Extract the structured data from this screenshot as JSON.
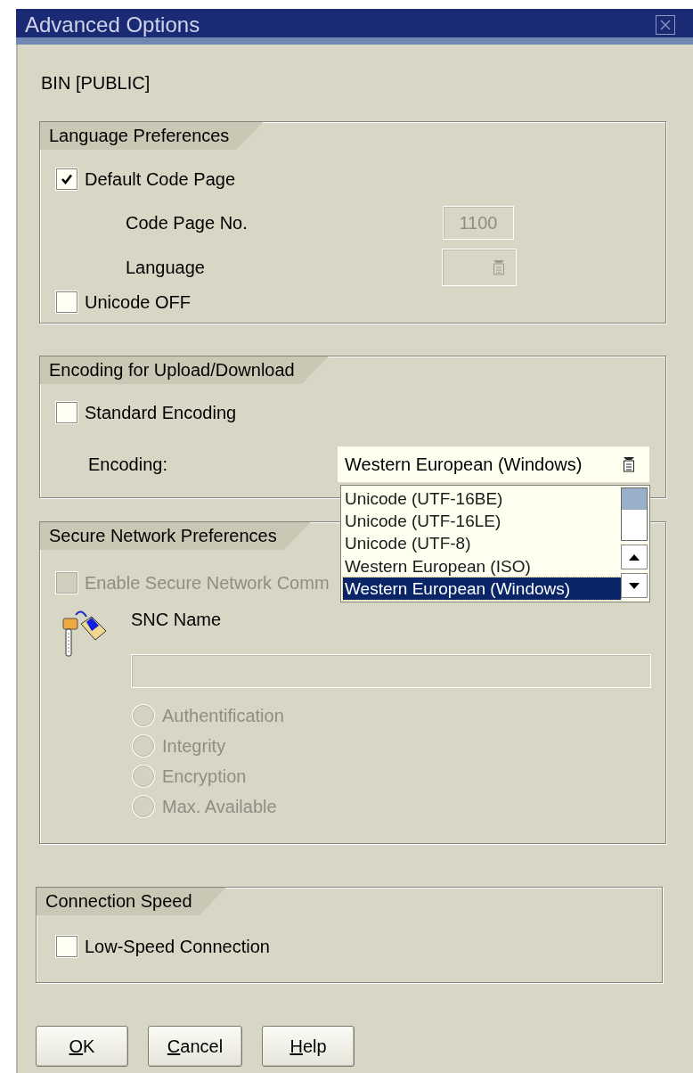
{
  "window": {
    "title": "Advanced Options"
  },
  "connection_label": "BIN [PUBLIC]",
  "language_preferences": {
    "title": "Language Preferences",
    "default_code_page": {
      "label": "Default Code Page",
      "checked": true
    },
    "code_page_no": {
      "label": "Code Page No.",
      "value": "1100",
      "disabled": true
    },
    "language": {
      "label": "Language",
      "disabled": true
    },
    "unicode_off": {
      "label": "Unicode OFF",
      "checked": false
    }
  },
  "encoding": {
    "title": "Encoding for Upload/Download",
    "standard_encoding": {
      "label": "Standard Encoding",
      "checked": false
    },
    "encoding_field": {
      "label": "Encoding:",
      "value": "Western European (Windows)",
      "expanded": true,
      "options": [
        {
          "label": "Unicode (UTF-16BE)",
          "selected": false
        },
        {
          "label": "Unicode (UTF-16LE)",
          "selected": false
        },
        {
          "label": "Unicode (UTF-8)",
          "selected": false
        },
        {
          "label": "Western European (ISO)",
          "selected": false
        },
        {
          "label": "Western European (Windows)",
          "selected": true
        }
      ]
    }
  },
  "secure_network": {
    "title": "Secure Network Preferences",
    "enable": {
      "label": "Enable Secure Network Comm",
      "checked": false,
      "disabled": true
    },
    "snc_name": {
      "label": "SNC Name",
      "disabled": true
    },
    "options": [
      {
        "label": "Authentification",
        "selected": false,
        "disabled": true
      },
      {
        "label": "Integrity",
        "selected": false,
        "disabled": true
      },
      {
        "label": "Encryption",
        "selected": false,
        "disabled": true
      },
      {
        "label": "Max. Available",
        "selected": false,
        "disabled": true
      }
    ]
  },
  "connection_speed": {
    "title": "Connection Speed",
    "low_speed": {
      "label": "Low-Speed Connection",
      "checked": false
    }
  },
  "buttons": [
    {
      "label": "OK",
      "first_letter_underlined": true
    },
    {
      "label": "Cancel",
      "first_letter_underlined": true
    },
    {
      "label": "Help",
      "first_letter_underlined": true
    }
  ]
}
